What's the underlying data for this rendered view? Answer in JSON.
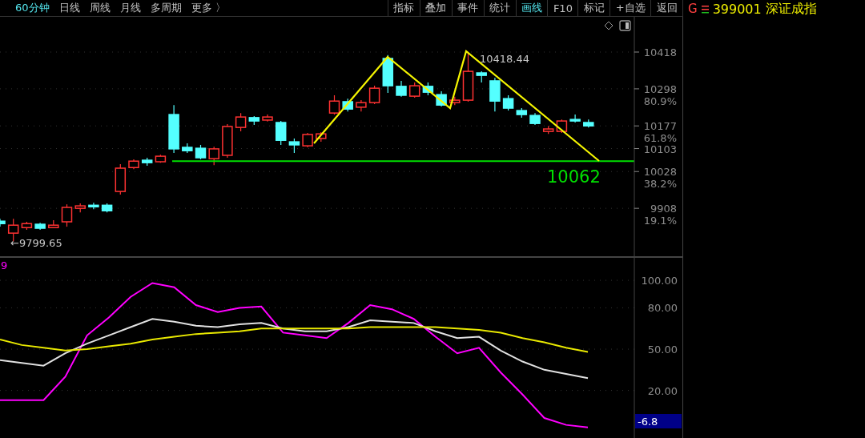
{
  "period_tabs": [
    {
      "label": "60分钟",
      "selected": true
    },
    {
      "label": "日线",
      "selected": false
    },
    {
      "label": "周线",
      "selected": false
    },
    {
      "label": "月线",
      "selected": false
    },
    {
      "label": "多周期",
      "selected": false
    },
    {
      "label": "更多 〉",
      "selected": false
    }
  ],
  "toolbar_buttons": [
    {
      "label": "指标",
      "selected": false
    },
    {
      "label": "叠加",
      "selected": false
    },
    {
      "label": "事件",
      "selected": false
    },
    {
      "label": "统计",
      "selected": false
    },
    {
      "label": "画线",
      "selected": true
    },
    {
      "label": "F10",
      "selected": false
    },
    {
      "label": "标记",
      "selected": false
    },
    {
      "label": "+自选",
      "selected": false
    },
    {
      "label": "返回",
      "selected": false
    }
  ],
  "security": {
    "flag": "G",
    "code": "399001",
    "name": "深证成指"
  },
  "price_chart": {
    "high_label": "10418.44",
    "low_label": "←9799.65",
    "chart_data": {
      "type": "candlestick",
      "grid": true,
      "ylim": [
        9749,
        10533
      ],
      "yticks": [
        {
          "value": 10418,
          "label": "10418"
        },
        {
          "value": 10298,
          "label": "10298 80.9%"
        },
        {
          "value": 10177,
          "label": "10177 61.8%"
        },
        {
          "value": 10103,
          "label": "10103"
        },
        {
          "value": 10028,
          "label": "10028 38.2%"
        },
        {
          "value": 9908,
          "label": "9908 19.1%"
        }
      ],
      "ref_lines": [
        {
          "axis": "y",
          "value": 10062,
          "color": "#00e000",
          "label": "10062"
        }
      ],
      "ohlc": [
        [
          9866,
          9874,
          9848,
          9858
        ],
        [
          9827,
          9874,
          9799.65,
          9853
        ],
        [
          9845,
          9864,
          9838,
          9858
        ],
        [
          9856,
          9861,
          9838,
          9843
        ],
        [
          9845,
          9869,
          9843,
          9853
        ],
        [
          9864,
          9921,
          9848,
          9911
        ],
        [
          9908,
          9924,
          9895,
          9916
        ],
        [
          9918,
          9926,
          9905,
          9913
        ],
        [
          9918,
          9924,
          9895,
          9900
        ],
        [
          9963,
          10052,
          9953,
          10039
        ],
        [
          10041,
          10068,
          10036,
          10062
        ],
        [
          10065,
          10073,
          10047,
          10057
        ],
        [
          10060,
          10083,
          10057,
          10078
        ],
        [
          10214,
          10245,
          10089,
          10102
        ],
        [
          10107,
          10120,
          10089,
          10096
        ],
        [
          10104,
          10115,
          10068,
          10073
        ],
        [
          10070,
          10109,
          10049,
          10102
        ],
        [
          10081,
          10183,
          10073,
          10175
        ],
        [
          10172,
          10219,
          10159,
          10206
        ],
        [
          10204,
          10209,
          10180,
          10193
        ],
        [
          10196,
          10214,
          10191,
          10206
        ],
        [
          10188,
          10193,
          10115,
          10130
        ],
        [
          10125,
          10136,
          10089,
          10115
        ],
        [
          10112,
          10154,
          10107,
          10149
        ],
        [
          10136,
          10157,
          10125,
          10151
        ],
        [
          10219,
          10277,
          10214,
          10258
        ],
        [
          10256,
          10266,
          10224,
          10232
        ],
        [
          10238,
          10261,
          10224,
          10253
        ],
        [
          10253,
          10308,
          10248,
          10300
        ],
        [
          10397,
          10408,
          10285,
          10308
        ],
        [
          10306,
          10324,
          10272,
          10277
        ],
        [
          10274,
          10319,
          10269,
          10308
        ],
        [
          10306,
          10319,
          10277,
          10287
        ],
        [
          10279,
          10290,
          10240,
          10245
        ],
        [
          10253,
          10272,
          10245,
          10261
        ],
        [
          10261,
          10418.44,
          10256,
          10355
        ],
        [
          10350,
          10355,
          10319,
          10342
        ],
        [
          10324,
          10334,
          10224,
          10258
        ],
        [
          10266,
          10277,
          10227,
          10235
        ],
        [
          10227,
          10235,
          10204,
          10214
        ],
        [
          10211,
          10219,
          10180,
          10185
        ],
        [
          10159,
          10177,
          10151,
          10167
        ],
        [
          10159,
          10198,
          10154,
          10193
        ],
        [
          10198,
          10214,
          10188,
          10193
        ],
        [
          10188,
          10198,
          10172,
          10177
        ]
      ]
    }
  },
  "indicator": {
    "label": "9",
    "current_value": "-6.8",
    "chart_data": {
      "type": "line",
      "grid": true,
      "ylim": [
        -15.1,
        116.9
      ],
      "yticks": [
        {
          "value": 100,
          "label": "100.00"
        },
        {
          "value": 80,
          "label": "80.00"
        },
        {
          "value": 50,
          "label": "50.00"
        },
        {
          "value": 20,
          "label": "20.00"
        }
      ],
      "series": [
        {
          "color": "#ff00ff",
          "values": [
            13,
            13,
            13,
            30,
            60,
            73,
            88,
            98,
            95,
            82,
            77,
            80,
            81,
            62,
            60,
            58,
            69,
            82,
            79,
            72,
            59,
            47,
            51,
            33,
            17,
            0,
            -5,
            -6.8
          ]
        },
        {
          "color": "#e0e0e0",
          "values": [
            42,
            40,
            38,
            47,
            54,
            60,
            66,
            72,
            70,
            67,
            66,
            68,
            69,
            65,
            63,
            63,
            66,
            71,
            70,
            69,
            63,
            58,
            59,
            49,
            41,
            35,
            32,
            29
          ]
        },
        {
          "color": "#e8e800",
          "values": [
            57,
            53,
            51,
            49,
            50,
            52,
            54,
            57,
            59,
            61,
            62,
            63,
            65,
            65,
            65,
            65,
            65,
            66,
            66,
            66,
            66,
            65,
            64,
            62,
            58,
            55,
            51,
            48
          ]
        }
      ]
    }
  }
}
